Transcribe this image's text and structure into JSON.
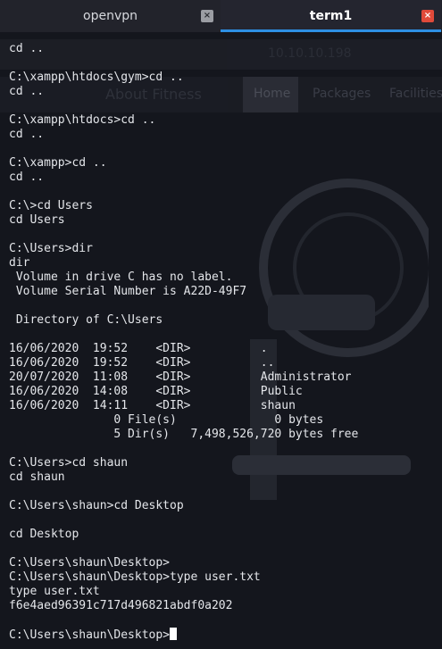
{
  "tabs": [
    {
      "label": "openvpn",
      "close_icon": "×"
    },
    {
      "label": "term1",
      "close_icon": "×"
    }
  ],
  "background": {
    "url": "10.10.10.198",
    "nav_title": "About Fitness",
    "nav_home": "Home",
    "nav_packages": "Packages",
    "nav_facilities": "Facilities"
  },
  "terminal": {
    "lines": [
      "cd ..",
      "",
      "C:\\xampp\\htdocs\\gym>cd ..",
      "cd ..",
      "",
      "C:\\xampp\\htdocs>cd ..",
      "cd ..",
      "",
      "C:\\xampp>cd ..",
      "cd ..",
      "",
      "C:\\>cd Users",
      "cd Users",
      "",
      "C:\\Users>dir",
      "dir",
      " Volume in drive C has no label.",
      " Volume Serial Number is A22D-49F7",
      "",
      " Directory of C:\\Users",
      "",
      "16/06/2020  19:52    <DIR>          .",
      "16/06/2020  19:52    <DIR>          ..",
      "20/07/2020  11:08    <DIR>          Administrator",
      "16/06/2020  14:08    <DIR>          Public",
      "16/06/2020  14:11    <DIR>          shaun",
      "               0 File(s)              0 bytes",
      "               5 Dir(s)   7,498,526,720 bytes free",
      "",
      "C:\\Users>cd shaun",
      "cd shaun",
      "",
      "C:\\Users\\shaun>cd Desktop",
      "",
      "cd Desktop",
      "",
      "C:\\Users\\shaun\\Desktop>",
      "C:\\Users\\shaun\\Desktop>type user.txt",
      "type user.txt",
      "f6e4aed96391c717d496821abdf0a202",
      "",
      "C:\\Users\\shaun\\Desktop>"
    ]
  }
}
